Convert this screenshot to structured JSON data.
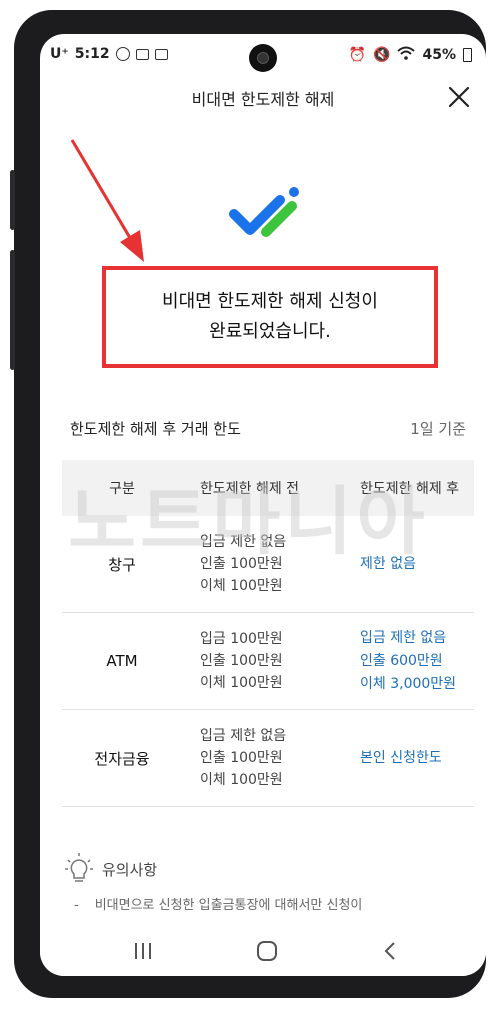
{
  "status": {
    "carrier": "U⁺",
    "time": "5:12",
    "battery": "45%"
  },
  "header": {
    "title": "비대면 한도제한 해제"
  },
  "message": {
    "line1": "비대면 한도제한 해제 신청이",
    "line2": "완료되었습니다."
  },
  "limits": {
    "title": "한도제한 해제 후 거래 한도",
    "basis": "1일 기준",
    "columns": [
      "구분",
      "한도제한 해제 전",
      "한도제한 해제 후"
    ],
    "rows": [
      {
        "category": "창구",
        "before": [
          "입금 제한 없음",
          "인출 100만원",
          "이체 100만원"
        ],
        "after": [
          "제한 없음"
        ]
      },
      {
        "category": "ATM",
        "before": [
          "입금 100만원",
          "인출 100만원",
          "이체 100만원"
        ],
        "after": [
          "입금 제한 없음",
          "인출 600만원",
          "이체 3,000만원"
        ]
      },
      {
        "category": "전자금융",
        "before": [
          "입금 제한 없음",
          "인출 100만원",
          "이체 100만원"
        ],
        "after": [
          "본인 신청한도"
        ]
      }
    ]
  },
  "watermark": "노트마니아",
  "notice": {
    "label": "유의사항",
    "item1": "비대면으로 신청한 입출금통장에 대해서만 신청이"
  },
  "colors": {
    "accent_blue": "#1e6fb8",
    "highlight_red": "#e63232",
    "logo_blue": "#1a73e8",
    "logo_green": "#3cc43c"
  }
}
